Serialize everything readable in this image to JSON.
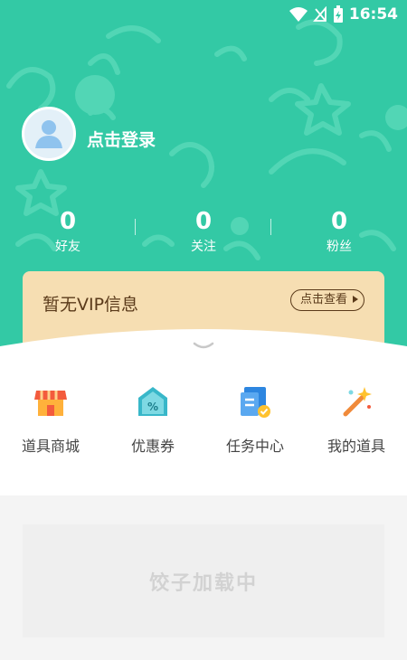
{
  "status_bar": {
    "time": "16:54"
  },
  "profile": {
    "login_label": "点击登录"
  },
  "stats": [
    {
      "value": "0",
      "label": "好友"
    },
    {
      "value": "0",
      "label": "关注"
    },
    {
      "value": "0",
      "label": "粉丝"
    }
  ],
  "vip": {
    "title": "暂无VIP信息",
    "button_label": "点击查看"
  },
  "menu": [
    {
      "label": "道具商城",
      "icon": "shop-icon"
    },
    {
      "label": "优惠券",
      "icon": "coupon-icon"
    },
    {
      "label": "任务中心",
      "icon": "task-center-icon"
    },
    {
      "label": "我的道具",
      "icon": "magic-wand-icon"
    }
  ],
  "loading": {
    "text": "饺子加载中"
  },
  "colors": {
    "header_bg": "#33c9a5",
    "vip_bg": "#f6deb2",
    "vip_text": "#5a3a1a"
  }
}
